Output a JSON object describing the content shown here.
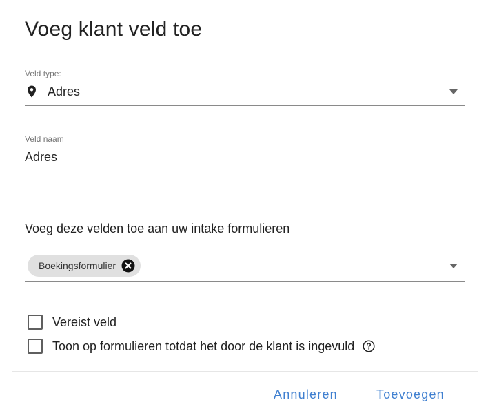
{
  "dialog": {
    "title": "Voeg klant veld toe"
  },
  "field_type": {
    "label": "Veld type:",
    "value": "Adres",
    "icon": "map-pin-icon"
  },
  "field_name": {
    "label": "Veld naam",
    "value": "Adres"
  },
  "intake_forms": {
    "heading": "Voeg deze velden toe aan uw intake formulieren",
    "chips": [
      {
        "label": "Boekingsformulier"
      }
    ]
  },
  "options": {
    "required_label": "Vereist veld",
    "required_checked": false,
    "show_until_filled_label": "Toon op formulieren totdat het door de klant is ingevuld",
    "show_until_filled_checked": false
  },
  "actions": {
    "cancel_label": "Annuleren",
    "add_label": "Toevoegen"
  },
  "colors": {
    "accent": "#3f7fd0",
    "chip_background": "#e0e0e0",
    "underline": "#8a8a8a"
  }
}
